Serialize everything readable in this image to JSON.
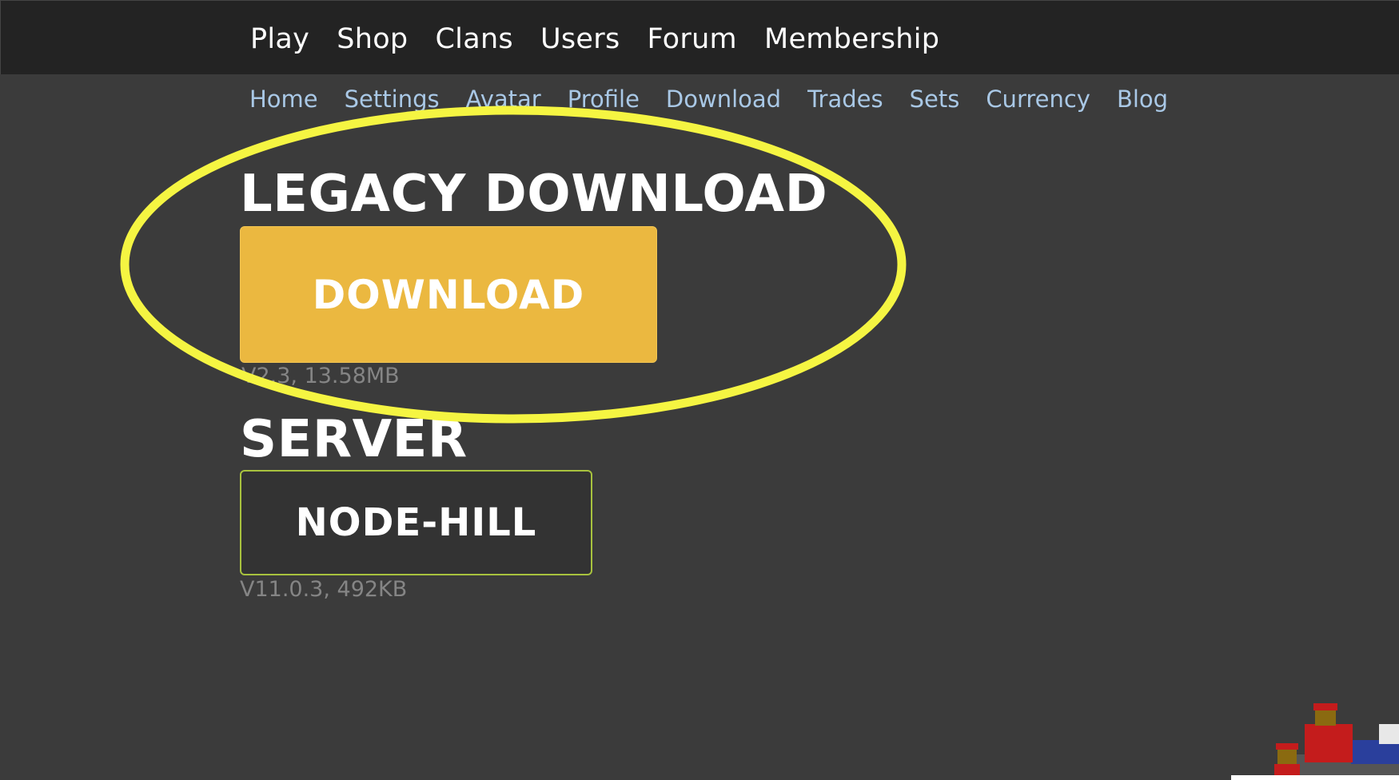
{
  "top_nav": {
    "items": [
      "Play",
      "Shop",
      "Clans",
      "Users",
      "Forum",
      "Membership"
    ]
  },
  "sub_nav": {
    "items": [
      "Home",
      "Settings",
      "Avatar",
      "Profile",
      "Download",
      "Trades",
      "Sets",
      "Currency",
      "Blog"
    ]
  },
  "legacy": {
    "heading": "LEGACY DOWNLOAD",
    "button_label": "DOWNLOAD",
    "version_info": "V2.3, 13.58MB"
  },
  "server": {
    "heading": "SERVER",
    "button_label": "NODE-HILL",
    "version_info": "V11.0.3, 492KB"
  },
  "colors": {
    "background": "#3b3b3b",
    "topbar": "#232323",
    "download_button": "#ebb840",
    "server_border": "#a8c23e",
    "subnav_link": "#a9c8e6",
    "annotation_circle": "#f5f542"
  }
}
